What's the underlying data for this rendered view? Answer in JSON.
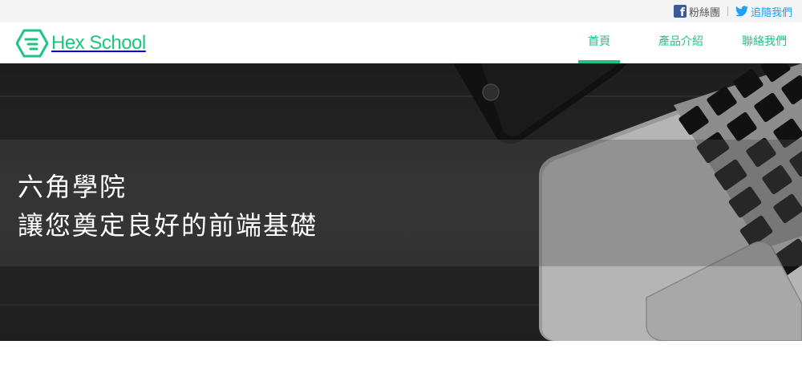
{
  "social": {
    "facebook_label": "粉絲團",
    "twitter_label": "追隨我們"
  },
  "brand": {
    "name": "Hex School",
    "accent_color": "#1ec386"
  },
  "nav": {
    "items": [
      {
        "label": "首頁",
        "active": true
      },
      {
        "label": "產品介紹",
        "active": false
      },
      {
        "label": "聯絡我們",
        "active": false
      }
    ]
  },
  "hero": {
    "line1": "六角學院",
    "line2": "讓您奠定良好的前端基礎"
  },
  "icons": {
    "facebook": "facebook-icon",
    "twitter": "twitter-icon",
    "logo": "hexagon-logo-icon"
  }
}
